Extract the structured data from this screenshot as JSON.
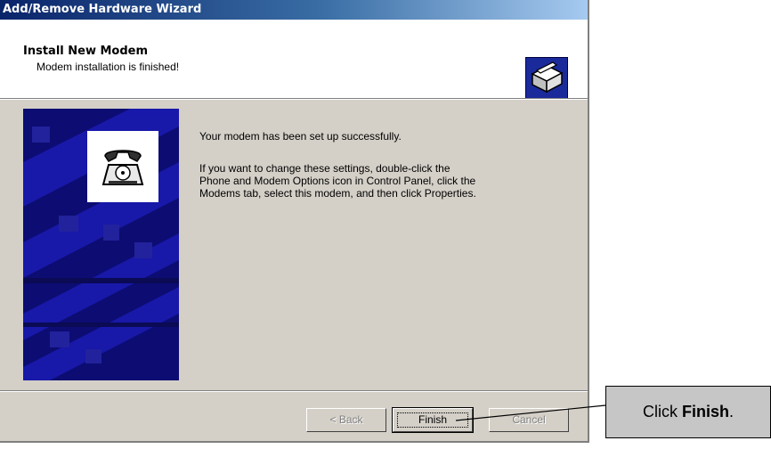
{
  "window": {
    "title": "Add/Remove Hardware Wizard"
  },
  "header": {
    "title": "Install New Modem",
    "subtitle": "Modem installation is finished!"
  },
  "content": {
    "line1": "Your modem has been set up successfully.",
    "line2": "If you want to change these settings, double-click the",
    "line3": "Phone and Modem Options icon in Control Panel, click the",
    "line4": "Modems tab, select this modem, and then click Properties."
  },
  "buttons": {
    "back": "< Back",
    "finish": "Finish",
    "cancel": "Cancel"
  },
  "callout": {
    "prefix": "Click ",
    "bold": "Finish",
    "suffix": "."
  },
  "icons": {
    "header": "modem-card-icon",
    "side": "telephone-icon"
  },
  "colors": {
    "titlebar": "#0a246a",
    "dialog": "#d4d0c8",
    "art": "#0c0c72"
  }
}
